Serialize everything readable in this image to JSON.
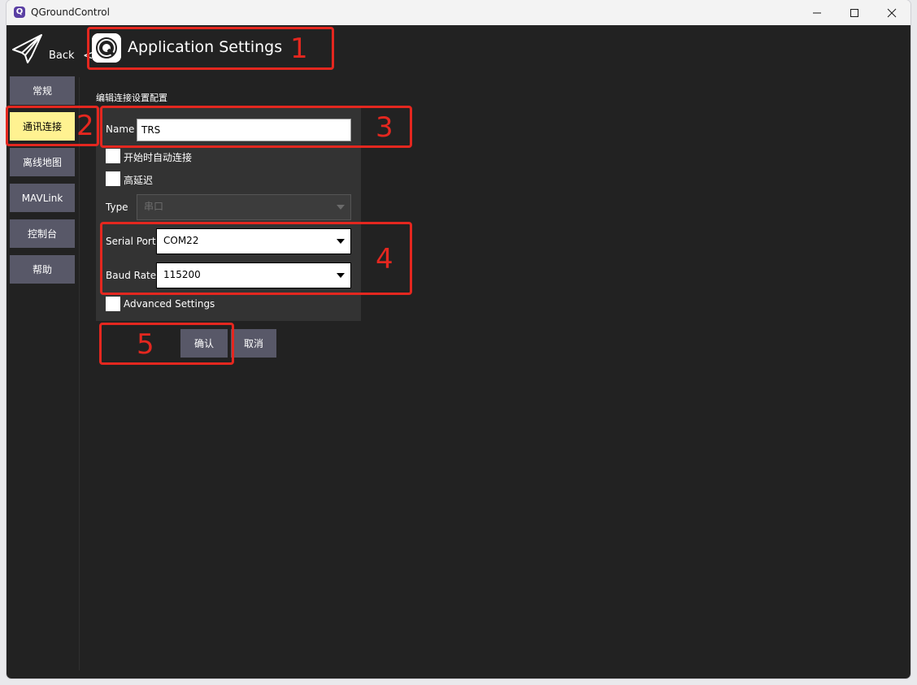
{
  "window": {
    "title": "QGroundControl",
    "app_icon_glyph": "Q"
  },
  "header": {
    "back_label": "Back",
    "chevron": "<",
    "title": "Application Settings"
  },
  "sidebar": {
    "items": [
      {
        "label": "常规",
        "active": false
      },
      {
        "label": "通讯连接",
        "active": true
      },
      {
        "label": "离线地图",
        "active": false
      },
      {
        "label": "MAVLink",
        "active": false
      },
      {
        "label": "控制台",
        "active": false
      },
      {
        "label": "帮助",
        "active": false
      }
    ]
  },
  "form": {
    "section_title": "编辑连接设置配置",
    "name_label": "Name",
    "name_value": "TRS",
    "auto_connect_label": "开始时自动连接",
    "high_latency_label": "高延迟",
    "type_label": "Type",
    "type_value": "串口",
    "serial_port_label": "Serial Port",
    "serial_port_value": "COM22",
    "baud_rate_label": "Baud Rate",
    "baud_rate_value": "115200",
    "advanced_label": "Advanced Settings",
    "ok_label": "确认",
    "cancel_label": "取消"
  },
  "annotations": [
    "1",
    "2",
    "3",
    "4",
    "5"
  ],
  "colors": {
    "background": "#222222",
    "button": "#585868",
    "active_button": "#fff291",
    "annotation": "#e4271f"
  }
}
